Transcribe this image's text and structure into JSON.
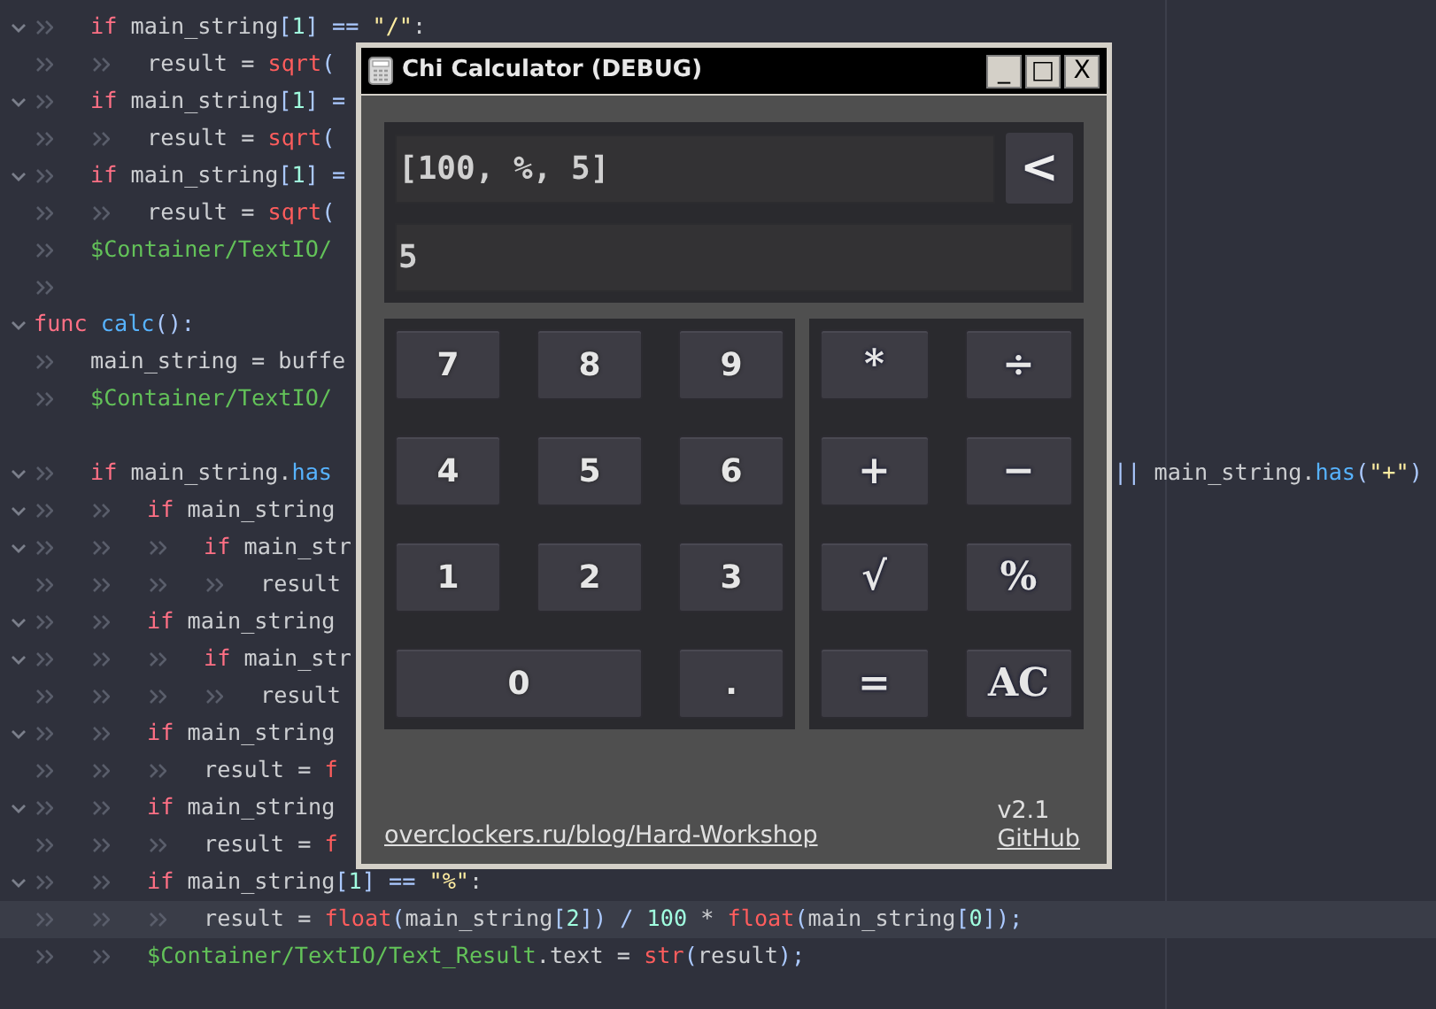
{
  "editor": {
    "lines": [
      {
        "children": [
          {
            "kind": "code",
            "fold": true,
            "current": false,
            "tokens": [
              {
                "text": "if ",
                "kind": "keyword"
              },
              {
                "text": "main_string",
                "kind": "plain"
              },
              {
                "text": "[",
                "kind": "bracket"
              },
              {
                "text": "1",
                "kind": "number"
              },
              {
                "text": "] == ",
                "kind": "bracket"
              },
              {
                "text": "\"/\"",
                "kind": "string"
              },
              {
                "text": ":",
                "kind": "plain"
              }
            ],
            "children": [
              {
                "kind": "code",
                "fold": false,
                "current": false,
                "tokens": [
                  {
                    "text": "result = ",
                    "kind": "plain"
                  },
                  {
                    "text": "sqrt",
                    "kind": "builtin"
                  },
                  {
                    "text": "(",
                    "kind": "bracket"
                  }
                ]
              }
            ]
          },
          {
            "kind": "code",
            "fold": true,
            "current": false,
            "tokens": [
              {
                "text": "if ",
                "kind": "keyword"
              },
              {
                "text": "main_string",
                "kind": "plain"
              },
              {
                "text": "[",
                "kind": "bracket"
              },
              {
                "text": "1",
                "kind": "number"
              },
              {
                "text": "] =",
                "kind": "bracket"
              }
            ],
            "children": [
              {
                "kind": "code",
                "fold": false,
                "current": false,
                "tokens": [
                  {
                    "text": "result = ",
                    "kind": "plain"
                  },
                  {
                    "text": "sqrt",
                    "kind": "builtin"
                  },
                  {
                    "text": "(",
                    "kind": "bracket"
                  }
                ]
              }
            ]
          },
          {
            "kind": "code",
            "fold": true,
            "current": false,
            "tokens": [
              {
                "text": "if ",
                "kind": "keyword"
              },
              {
                "text": "main_string",
                "kind": "plain"
              },
              {
                "text": "[",
                "kind": "bracket"
              },
              {
                "text": "1",
                "kind": "number"
              },
              {
                "text": "] =",
                "kind": "bracket"
              }
            ],
            "children": [
              {
                "kind": "code",
                "fold": false,
                "current": false,
                "tokens": [
                  {
                    "text": "result = ",
                    "kind": "plain"
                  },
                  {
                    "text": "sqrt",
                    "kind": "builtin"
                  },
                  {
                    "text": "(",
                    "kind": "bracket"
                  }
                ]
              }
            ]
          },
          {
            "kind": "code",
            "fold": false,
            "current": false,
            "tokens": [
              {
                "text": "$Container/TextIO/",
                "kind": "path"
              }
            ]
          },
          {
            "kind": "tab",
            "fold": false,
            "current": false
          }
        ]
      },
      {
        "kind": "code",
        "fold": true,
        "current": false,
        "tokens": [
          {
            "text": "func ",
            "kind": "keyword"
          },
          {
            "text": "calc",
            "kind": "function"
          },
          {
            "text": "():",
            "kind": "bracket"
          }
        ],
        "children": [
          {
            "kind": "code",
            "fold": false,
            "current": false,
            "tokens": [
              {
                "text": "main_string = buffe",
                "kind": "plain"
              }
            ]
          },
          {
            "kind": "code",
            "fold": false,
            "current": false,
            "tokens": [
              {
                "text": "$Container/TextIO/",
                "kind": "path"
              }
            ]
          },
          {
            "kind": "empty",
            "fold": false,
            "current": false
          },
          {
            "kind": "code",
            "fold": true,
            "current": false,
            "tokens": [
              {
                "text": "if ",
                "kind": "keyword"
              },
              {
                "text": "main_string.",
                "kind": "plain"
              },
              {
                "text": "has",
                "kind": "function"
              }
            ],
            "tail": [
              {
                "text": "|| ",
                "kind": "bracket"
              },
              {
                "text": "main_string.",
                "kind": "plain"
              },
              {
                "text": "has",
                "kind": "function"
              },
              {
                "text": "(",
                "kind": "bracket"
              },
              {
                "text": "\"+\"",
                "kind": "string"
              },
              {
                "text": ")",
                "kind": "bracket"
              }
            ],
            "children": [
              {
                "kind": "code",
                "fold": true,
                "current": false,
                "tokens": [
                  {
                    "text": "if ",
                    "kind": "keyword"
                  },
                  {
                    "text": "main_string",
                    "kind": "plain"
                  }
                ],
                "children": [
                  {
                    "kind": "code",
                    "fold": true,
                    "current": false,
                    "tokens": [
                      {
                        "text": "if ",
                        "kind": "keyword"
                      },
                      {
                        "text": "main_str",
                        "kind": "plain"
                      }
                    ],
                    "children": [
                      {
                        "kind": "code",
                        "fold": false,
                        "current": false,
                        "tokens": [
                          {
                            "text": "result",
                            "kind": "plain"
                          }
                        ]
                      }
                    ]
                  }
                ]
              },
              {
                "kind": "code",
                "fold": true,
                "current": false,
                "tokens": [
                  {
                    "text": "if ",
                    "kind": "keyword"
                  },
                  {
                    "text": "main_string",
                    "kind": "plain"
                  }
                ],
                "children": [
                  {
                    "kind": "code",
                    "fold": true,
                    "current": false,
                    "tokens": [
                      {
                        "text": "if ",
                        "kind": "keyword"
                      },
                      {
                        "text": "main_str",
                        "kind": "plain"
                      }
                    ],
                    "children": [
                      {
                        "kind": "code",
                        "fold": false,
                        "current": false,
                        "tokens": [
                          {
                            "text": "result",
                            "kind": "plain"
                          }
                        ]
                      }
                    ]
                  }
                ]
              },
              {
                "kind": "code",
                "fold": true,
                "current": false,
                "tokens": [
                  {
                    "text": "if ",
                    "kind": "keyword"
                  },
                  {
                    "text": "main_string",
                    "kind": "plain"
                  }
                ],
                "children": [
                  {
                    "kind": "code",
                    "fold": false,
                    "current": false,
                    "tokens": [
                      {
                        "text": "result = ",
                        "kind": "plain"
                      },
                      {
                        "text": "f",
                        "kind": "builtin"
                      }
                    ]
                  }
                ]
              },
              {
                "kind": "code",
                "fold": true,
                "current": false,
                "tokens": [
                  {
                    "text": "if ",
                    "kind": "keyword"
                  },
                  {
                    "text": "main_string",
                    "kind": "plain"
                  }
                ],
                "children": [
                  {
                    "kind": "code",
                    "fold": false,
                    "current": false,
                    "tokens": [
                      {
                        "text": "result = ",
                        "kind": "plain"
                      },
                      {
                        "text": "f",
                        "kind": "builtin"
                      }
                    ]
                  }
                ]
              },
              {
                "kind": "code",
                "fold": true,
                "current": false,
                "tokens": [
                  {
                    "text": "if ",
                    "kind": "keyword"
                  },
                  {
                    "text": "main_string",
                    "kind": "plain"
                  },
                  {
                    "text": "[",
                    "kind": "bracket"
                  },
                  {
                    "text": "1",
                    "kind": "number"
                  },
                  {
                    "text": "] == ",
                    "kind": "bracket"
                  },
                  {
                    "text": "\"%\"",
                    "kind": "string"
                  },
                  {
                    "text": ":",
                    "kind": "plain"
                  }
                ],
                "children": [
                  {
                    "kind": "code",
                    "fold": false,
                    "current": true,
                    "tokens": [
                      {
                        "text": "result = ",
                        "kind": "plain"
                      },
                      {
                        "text": "float",
                        "kind": "builtin"
                      },
                      {
                        "text": "(",
                        "kind": "bracket"
                      },
                      {
                        "text": "main_string",
                        "kind": "plain"
                      },
                      {
                        "text": "[",
                        "kind": "bracket"
                      },
                      {
                        "text": "2",
                        "kind": "number"
                      },
                      {
                        "text": "]) / ",
                        "kind": "bracket"
                      },
                      {
                        "text": "100",
                        "kind": "number"
                      },
                      {
                        "text": " * ",
                        "kind": "plain"
                      },
                      {
                        "text": "float",
                        "kind": "builtin"
                      },
                      {
                        "text": "(",
                        "kind": "bracket"
                      },
                      {
                        "text": "main_string",
                        "kind": "plain"
                      },
                      {
                        "text": "[",
                        "kind": "bracket"
                      },
                      {
                        "text": "0",
                        "kind": "number"
                      },
                      {
                        "text": "]);",
                        "kind": "bracket"
                      }
                    ]
                  }
                ]
              },
              {
                "kind": "code",
                "fold": false,
                "current": false,
                "tokens": [
                  {
                    "text": "$Container/TextIO/Text_Result",
                    "kind": "path"
                  },
                  {
                    "text": ".text = ",
                    "kind": "plain"
                  },
                  {
                    "text": "str",
                    "kind": "builtin"
                  },
                  {
                    "text": "(",
                    "kind": "bracket"
                  },
                  {
                    "text": "result",
                    "kind": "plain"
                  },
                  {
                    "text": ");",
                    "kind": "bracket"
                  }
                ]
              }
            ]
          }
        ]
      }
    ]
  },
  "window": {
    "title": "Chi Calculator (DEBUG)",
    "controls": [
      "_",
      "□",
      "X"
    ],
    "expression": "[100, %, 5]",
    "backspace": "<",
    "result": "5",
    "digits": [
      {
        "label": "7",
        "wide": false
      },
      {
        "label": "8",
        "wide": false
      },
      {
        "label": "9",
        "wide": false
      },
      {
        "label": "4",
        "wide": false
      },
      {
        "label": "5",
        "wide": false
      },
      {
        "label": "6",
        "wide": false
      },
      {
        "label": "1",
        "wide": false
      },
      {
        "label": "2",
        "wide": false
      },
      {
        "label": "3",
        "wide": false
      },
      {
        "label": "0",
        "wide": true
      },
      {
        "label": ".",
        "wide": false
      }
    ],
    "operators": [
      "*",
      "÷",
      "+",
      "−",
      "√",
      "%",
      "=",
      "AC"
    ],
    "link": "overclockers.ru/blog/Hard-Workshop",
    "version": "v2.1",
    "github": "GitHub"
  }
}
